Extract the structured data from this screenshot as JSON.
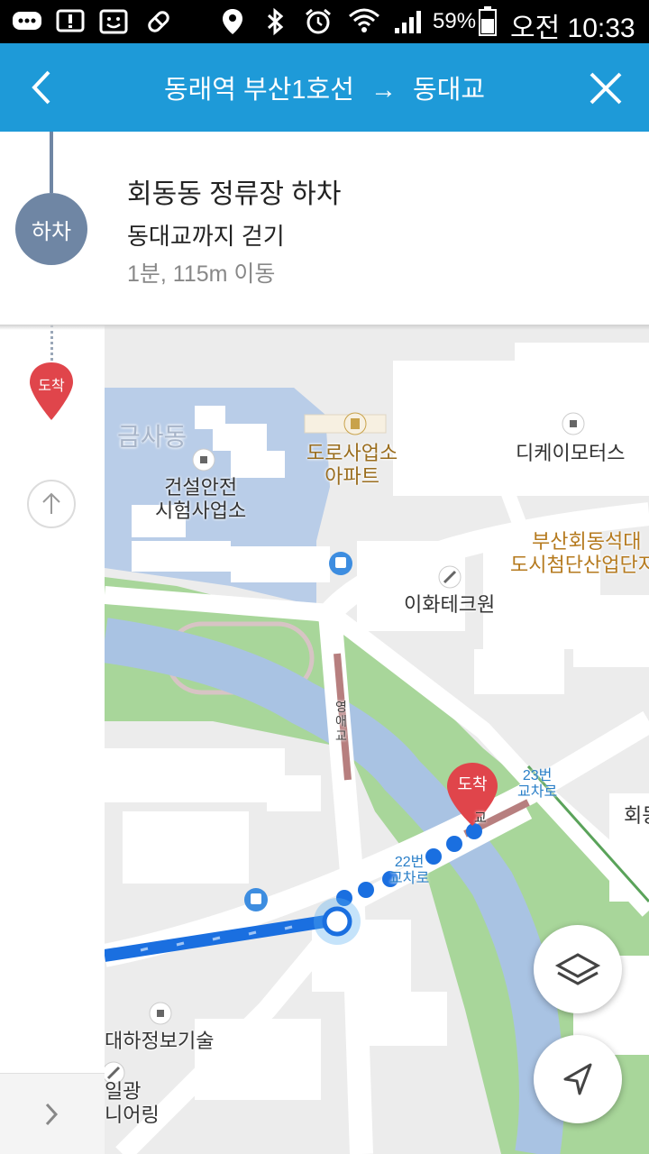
{
  "status_bar": {
    "battery_percent": "59%",
    "time": "오전 10:33",
    "icons": [
      "message-icon",
      "alert-icon",
      "face-icon",
      "pill-icon",
      "location-icon",
      "bluetooth-icon",
      "alarm-icon",
      "wifi-icon",
      "signal-icon",
      "battery-icon"
    ]
  },
  "header": {
    "origin": "동래역 부산1호선",
    "arrow": "→",
    "destination": "동대교",
    "back_icon": "chevron-left-icon",
    "close_icon": "close-icon",
    "background": "#1e9ad8"
  },
  "step": {
    "badge": "하차",
    "title": "회동동 정류장 하차",
    "subtitle": "동대교까지 걷기",
    "meta": "1분, 115m 이동",
    "badge_color": "#6f86a4"
  },
  "rail": {
    "arrive_label": "도착",
    "arrive_color": "#e0454b",
    "up_icon": "arrow-up-icon",
    "expand_icon": "chevron-right-icon"
  },
  "map": {
    "destination_marker": "도착",
    "labels": {
      "geumsa": "금사동",
      "construction_line1": "건설안전",
      "construction_line2": "시험사업소",
      "road_apt_line1": "도로사업소",
      "road_apt_line2": "아파트",
      "dk_motors": "디케이모터스",
      "busan_line1": "부산회동석대",
      "busan_line2": "도시첨단산업단지",
      "ihwa": "이화테크원",
      "hoedong": "회동",
      "daeha": "대하정보기술",
      "ilgwang_line1": "일광",
      "ilgwang_line2": "니어링",
      "bridge": "교"
    },
    "road_labels": {
      "r23_line1": "23번",
      "r23_line2": "교차로",
      "r22_line1": "22번",
      "r22_line2": "교차로",
      "bridge_a": "영",
      "bridge_b": "애",
      "bridge_c": "교"
    },
    "route_color": "#1a6fe0",
    "park_color": "#a8d69a",
    "water_color": "#a9c3e3"
  },
  "controls": {
    "layers_icon": "layers-icon",
    "locate_icon": "navigation-arrow-icon"
  }
}
